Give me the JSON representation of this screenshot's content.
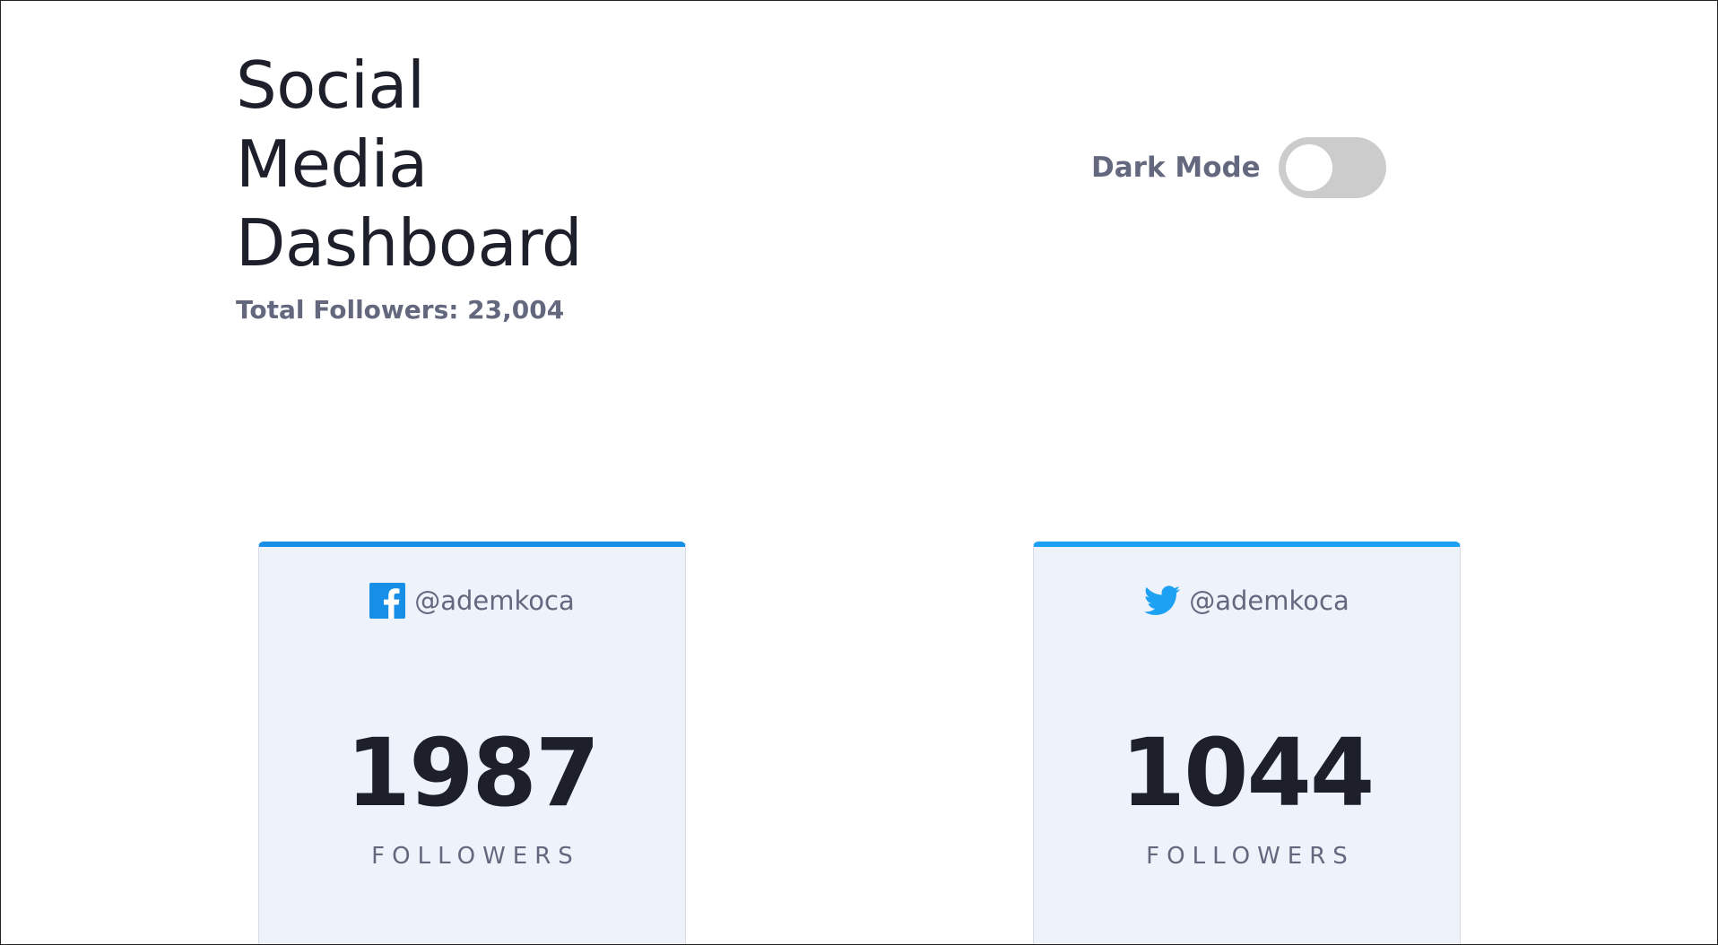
{
  "header": {
    "title_lines": [
      "Social",
      "Media",
      "Dashboard"
    ],
    "total_followers": "Total Followers: 23,004"
  },
  "dark_mode": {
    "label": "Dark Mode",
    "enabled": false
  },
  "cards": [
    {
      "platform_icon": "facebook-icon",
      "accent_color": "#178fe6",
      "handle": "@ademkoca",
      "count": "1987",
      "label": "FOLLOWERS"
    },
    {
      "platform_icon": "twitter-icon",
      "accent_color": "#1da1f2",
      "handle": "@ademkoca",
      "count": "1044",
      "label": "FOLLOWERS"
    }
  ]
}
